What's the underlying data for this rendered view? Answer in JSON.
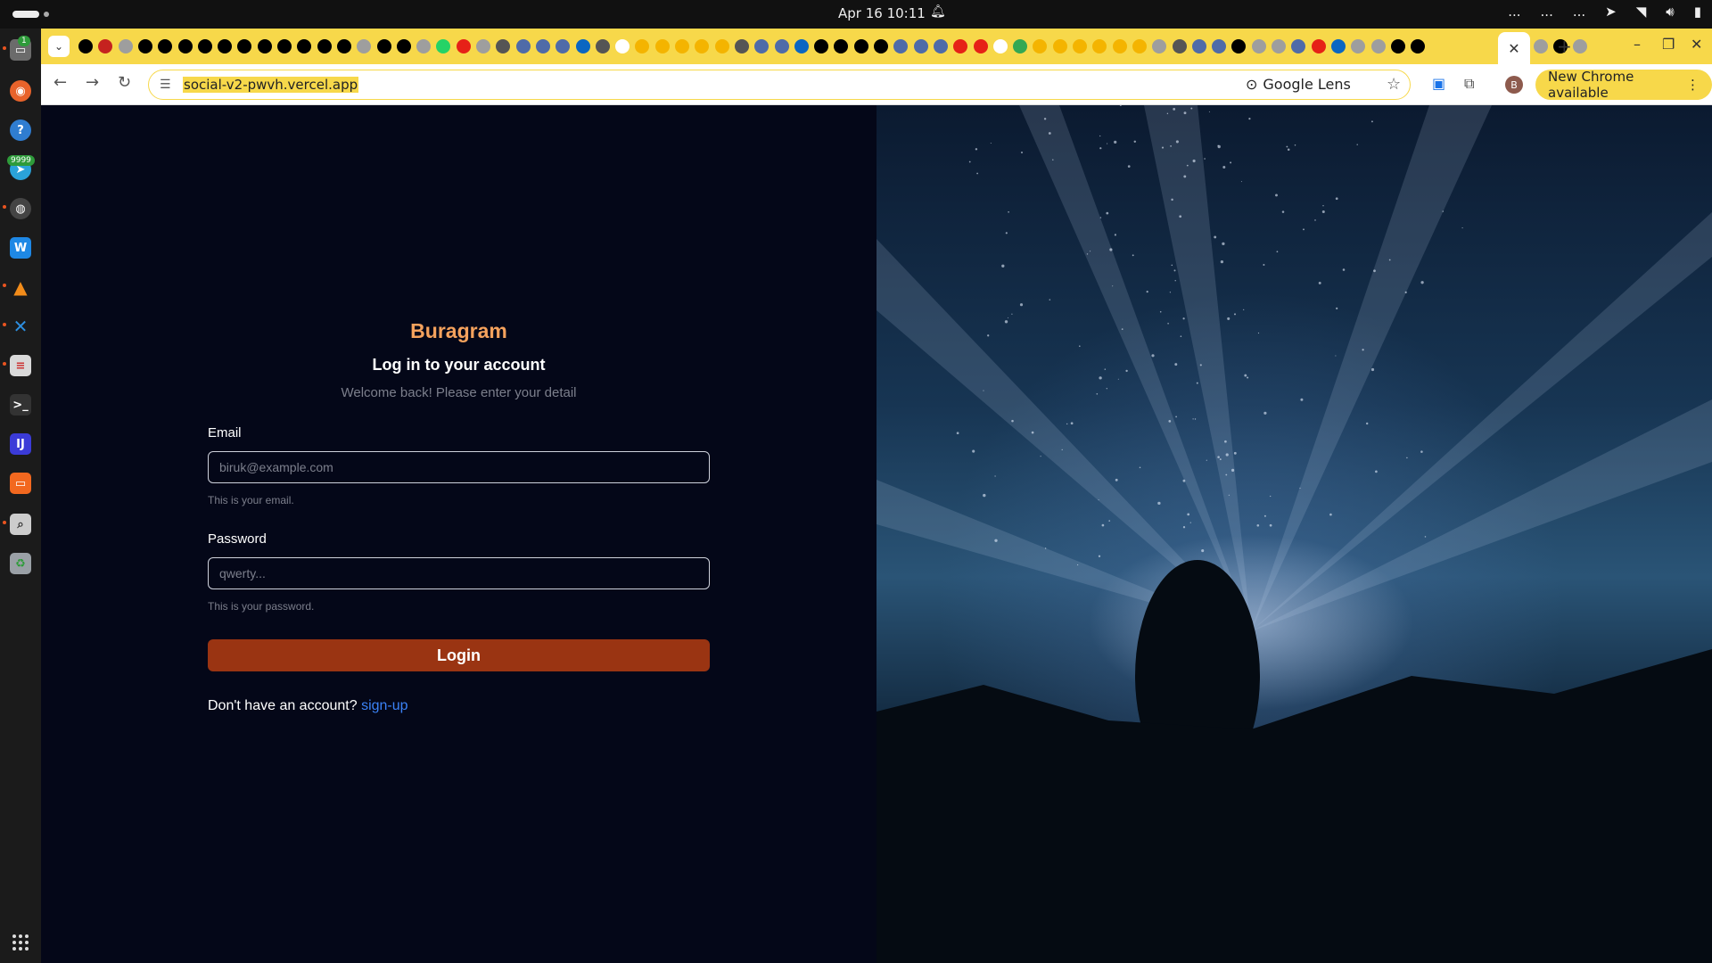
{
  "system": {
    "clock": "Apr 16  10:11",
    "tray_items": [
      "...",
      "...",
      "..."
    ]
  },
  "dock": {
    "badges": {
      "files": "1",
      "telegram": "9999"
    },
    "items": [
      "files",
      "firefox",
      "help",
      "telegram",
      "chrome",
      "webstorm",
      "vlc",
      "vscode",
      "text-editor",
      "terminal",
      "intellij",
      "slides",
      "screenshot",
      "trash"
    ]
  },
  "browser": {
    "url": "social-v2-pwvh.vercel.app",
    "google_lens_label": "Google Lens",
    "profile_initial": "B",
    "update_label": "New Chrome available",
    "active_tab_close": "✕",
    "new_tab": "+"
  },
  "login": {
    "brand": "Buragram",
    "heading": "Log in to your account",
    "subheading": "Welcome back! Please enter your detail",
    "email": {
      "label": "Email",
      "placeholder": "biruk@example.com",
      "help": "This is your email."
    },
    "password": {
      "label": "Password",
      "placeholder": "qwerty...",
      "help": "This is your password."
    },
    "submit_label": "Login",
    "signup_prompt": "Don't have an account?",
    "signup_link": "sign-up"
  },
  "colors": {
    "brand": "#f5a25d",
    "button": "#9a3412",
    "link": "#3b82f6",
    "page_bg": "#040718",
    "chrome_accent": "#f7d84a"
  }
}
